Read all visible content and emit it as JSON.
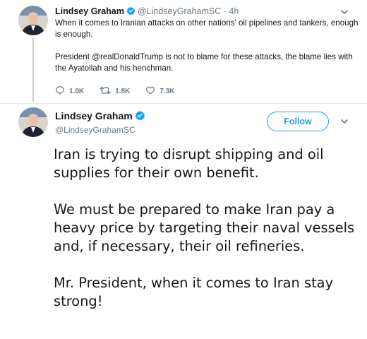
{
  "thread_tweet": {
    "author_name": "Lindsey Graham",
    "author_handle": "@LindseyGrahamSC",
    "time_separator": "·",
    "time": "4h",
    "paragraphs": [
      "When it comes to Iranian attacks on other nations' oil pipelines and tankers, enough is enough.",
      "President @realDonaldTrump is not to blame for these attacks, the blame lies with the Ayatollah and his henchman."
    ],
    "reply_count": "1.0K",
    "retweet_count": "1.8K",
    "like_count": "7.3K"
  },
  "main_tweet": {
    "author_name": "Lindsey Graham",
    "author_handle": "@LindseyGrahamSC",
    "follow_label": "Follow",
    "paragraphs": [
      "Iran is trying to disrupt shipping and oil supplies for their own benefit.",
      "We must be prepared to make Iran pay a heavy price by targeting their naval vessels and, if necessary, their oil refineries.",
      "Mr. President, when it comes to Iran stay strong!"
    ]
  },
  "icons": {
    "verified": "verified-badge-icon",
    "reply": "reply-icon",
    "retweet": "retweet-icon",
    "like": "like-icon",
    "chevron": "chevron-down-icon"
  },
  "colors": {
    "accent": "#1da1f2",
    "muted_text": "#657786",
    "primary_text": "#14171a",
    "divider": "#e6ecf0"
  }
}
